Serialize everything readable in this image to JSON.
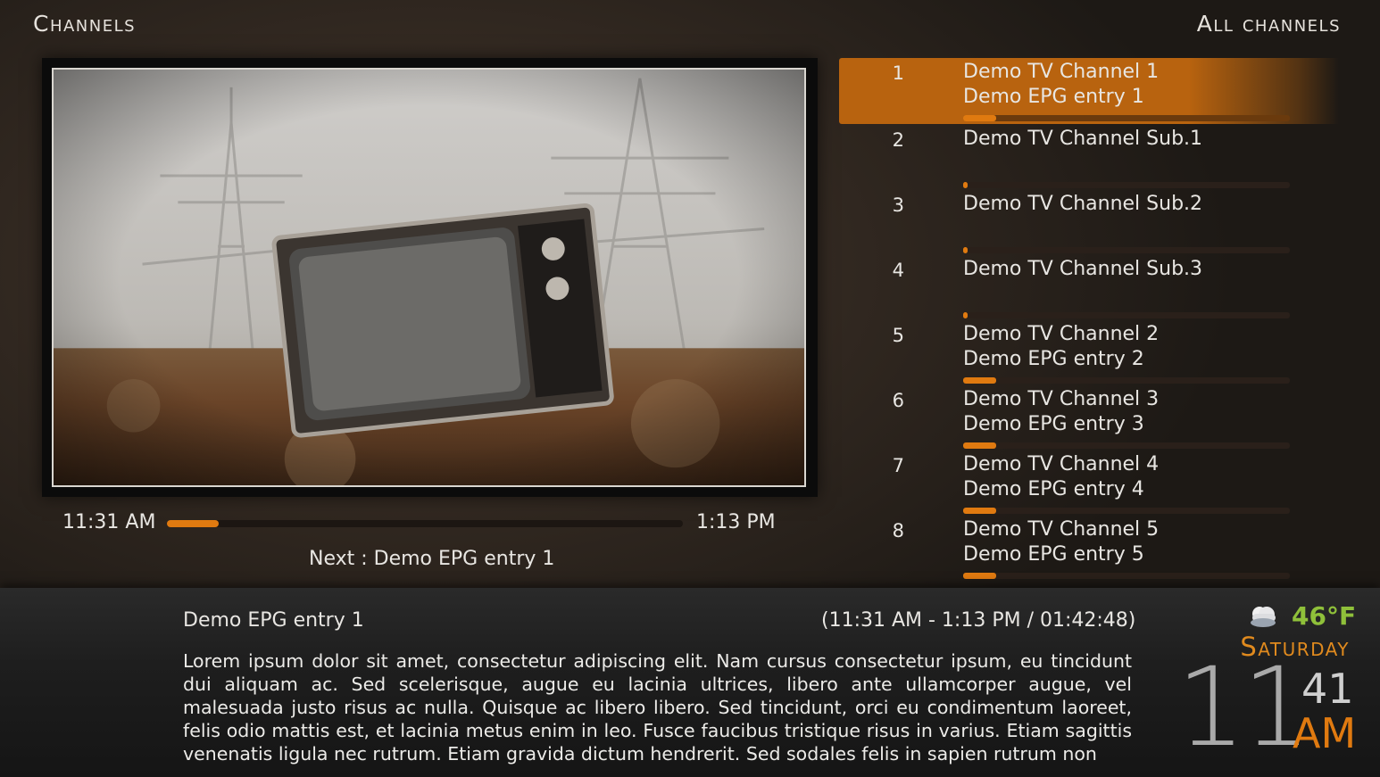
{
  "header": {
    "title": "Channels",
    "filter": "All channels"
  },
  "now_playing": {
    "start_time": "11:31 AM",
    "end_time": "1:13 PM",
    "progress_fraction": 0.1,
    "next_label": "Next : Demo EPG entry 1"
  },
  "channels": [
    {
      "number": "1",
      "name": "Demo TV Channel 1",
      "epg": "Demo EPG entry 1",
      "progress": 0.1,
      "selected": true
    },
    {
      "number": "2",
      "name": "Demo TV Channel Sub.1",
      "epg": "",
      "progress": 0.01,
      "selected": false
    },
    {
      "number": "3",
      "name": "Demo TV Channel Sub.2",
      "epg": "",
      "progress": 0.01,
      "selected": false
    },
    {
      "number": "4",
      "name": "Demo TV Channel Sub.3",
      "epg": "",
      "progress": 0.01,
      "selected": false
    },
    {
      "number": "5",
      "name": "Demo TV Channel 2",
      "epg": "Demo EPG entry 2",
      "progress": 0.1,
      "selected": false
    },
    {
      "number": "6",
      "name": "Demo TV Channel 3",
      "epg": "Demo EPG entry 3",
      "progress": 0.1,
      "selected": false
    },
    {
      "number": "7",
      "name": "Demo TV Channel 4",
      "epg": "Demo EPG entry 4",
      "progress": 0.1,
      "selected": false
    },
    {
      "number": "8",
      "name": "Demo TV Channel 5",
      "epg": "Demo EPG entry 5",
      "progress": 0.1,
      "selected": false
    }
  ],
  "info": {
    "title": "Demo EPG entry 1",
    "time_range": "(11:31 AM - 1:13 PM / 01:42:48)",
    "plot": "Lorem ipsum dolor sit amet, consectetur adipiscing elit. Nam cursus consectetur ipsum, eu tincidunt dui aliquam ac. Sed scelerisque, augue eu lacinia ultrices, libero ante ullamcorper augue, vel malesuada justo risus ac nulla. Quisque ac libero libero. Sed tincidunt, orci eu condimentum laoreet, felis odio mattis est, et lacinia metus enim in leo. Fusce faucibus tristique risus in varius. Etiam sagittis venenatis ligula nec rutrum. Etiam gravida dictum hendrerit. Sed sodales felis in sapien rutrum non"
  },
  "weather": {
    "icon": "cloudy-icon",
    "temperature": "46°F"
  },
  "clock": {
    "weekday": "Saturday",
    "hours": "11",
    "minutes": "41",
    "ampm": "AM"
  },
  "colors": {
    "accent": "#e07a10",
    "selected_row": "#b8630f",
    "temperature": "#8fc03a"
  }
}
